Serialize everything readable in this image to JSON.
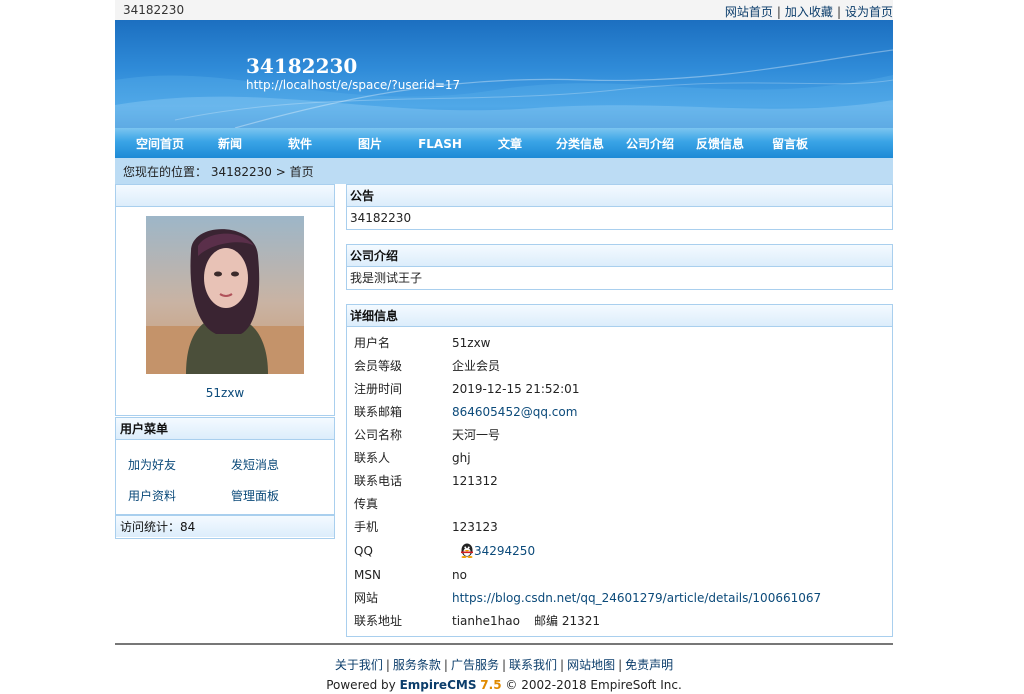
{
  "topbar": {
    "site_name": "34182230",
    "links": [
      "网站首页",
      "加入收藏",
      "设为首页"
    ],
    "separator": "|"
  },
  "banner": {
    "title": "34182230",
    "url": "http://localhost/e/space/?userid=17"
  },
  "nav": {
    "items": [
      "空间首页",
      "新闻",
      "软件",
      "图片",
      "FLASH",
      "文章",
      "分类信息",
      "公司介绍",
      "反馈信息",
      "留言板"
    ]
  },
  "breadcrumb": {
    "prefix": "您现在的位置：",
    "site": "34182230",
    "arrow": ">",
    "current": "首页"
  },
  "profile": {
    "username": "51zxw"
  },
  "user_menu": {
    "title": "用户菜单",
    "items": [
      "加为好友",
      "发短消息",
      "用户资料",
      "管理面板"
    ]
  },
  "stats": {
    "label": "访问统计：",
    "count": "84"
  },
  "notice": {
    "title": "公告",
    "body": "34182230"
  },
  "company": {
    "title": "公司介绍",
    "body": "我是测试王子"
  },
  "details": {
    "title": "详细信息",
    "rows": [
      {
        "label": "用户名",
        "value": "51zxw"
      },
      {
        "label": "会员等级",
        "value": "企业会员"
      },
      {
        "label": "注册时间",
        "value": "2019-12-15 21:52:01"
      },
      {
        "label": "联系邮箱",
        "value": "864605452@qq.com"
      },
      {
        "label": "公司名称",
        "value": "天河一号"
      },
      {
        "label": "联系人",
        "value": "ghj"
      },
      {
        "label": "联系电话",
        "value": "121312"
      },
      {
        "label": "传真",
        "value": ""
      },
      {
        "label": "手机",
        "value": "123123"
      },
      {
        "label": "QQ",
        "value": "34294250"
      },
      {
        "label": "MSN",
        "value": "no"
      },
      {
        "label": "网站",
        "value": "https://blog.csdn.net/qq_24601279/article/details/100661067"
      },
      {
        "label": "联系地址",
        "value": "tianhe1hao",
        "extra": "邮编 21321"
      }
    ]
  },
  "footer": {
    "links": [
      "关于我们",
      "服务条款",
      "广告服务",
      "联系我们",
      "网站地图",
      "免责声明"
    ],
    "separator": "|",
    "powered_by": "Powered by",
    "brand": "EmpireCMS",
    "version": "7.5",
    "copyright": "© 2002-2018 EmpireSoft Inc."
  },
  "colors": {
    "banner_blue": "#1c6fc0",
    "nav_blue": "#1d8ad6",
    "breadcrumb_bg": "#bcdcf4",
    "link_blue": "#0b4a7a",
    "version_orange": "#e08a00"
  }
}
